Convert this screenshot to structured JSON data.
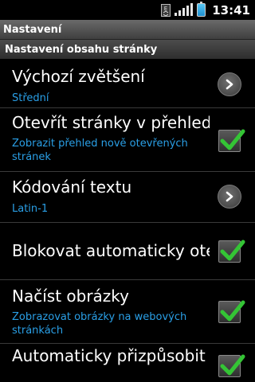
{
  "status_bar": {
    "time": "13:41"
  },
  "title_bar": {
    "title": "Nastavení"
  },
  "section": {
    "header": "Nastavení obsahu stránky"
  },
  "items": [
    {
      "title": "Výchozí zvětšení",
      "summary": "Střední",
      "widget": "chevron"
    },
    {
      "title": "Otevřít stránky v přehledu",
      "summary": "Zobrazit přehled nově otevřených stránek",
      "widget": "checkbox",
      "checked": true
    },
    {
      "title": "Kódování textu",
      "summary": "Latin-1",
      "widget": "chevron"
    },
    {
      "title": "Blokovat automaticky otevíraná okna",
      "summary": "",
      "widget": "checkbox",
      "checked": true
    },
    {
      "title": "Načíst obrázky",
      "summary": "Zobrazovat obrázky na webových stránkách",
      "widget": "checkbox",
      "checked": true
    },
    {
      "title": "Automaticky přizpůsobit",
      "summary": "",
      "widget": "checkbox",
      "checked": true
    }
  ],
  "colors": {
    "summary": "#2a9fe6",
    "check": "#34c435",
    "background": "#000000"
  },
  "icons": {
    "chevron": "chevron-right-icon",
    "check": "check-icon"
  }
}
